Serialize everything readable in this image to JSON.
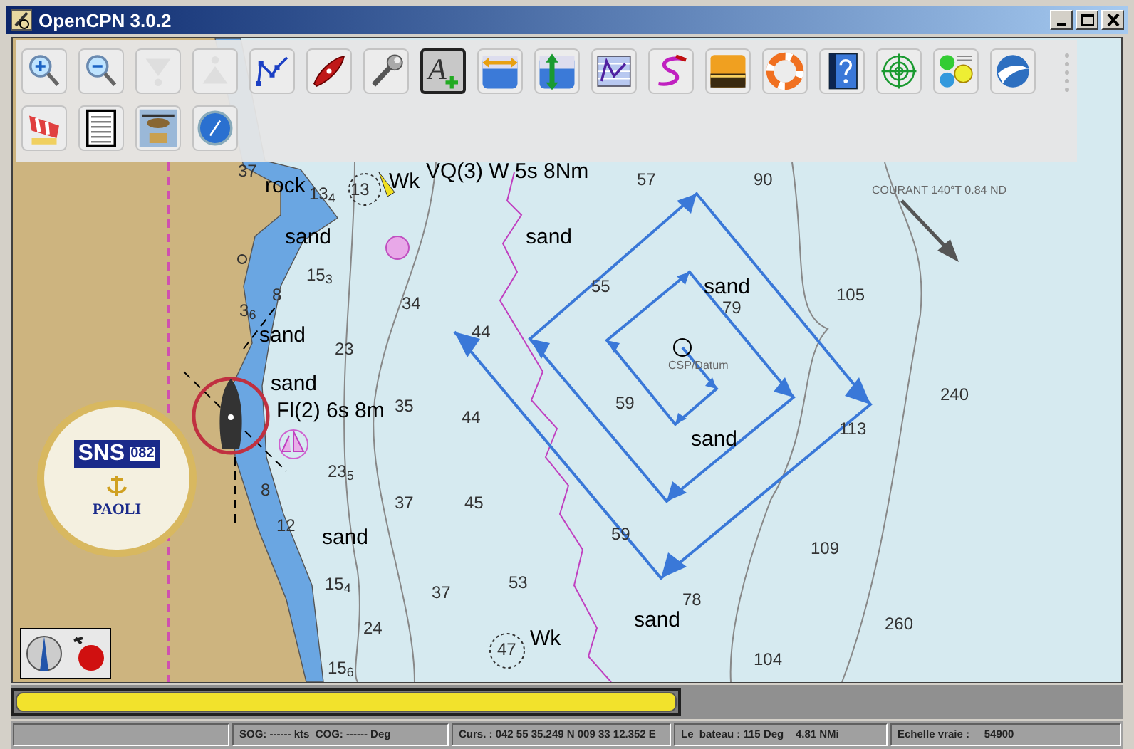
{
  "window": {
    "title": "OpenCPN 3.0.2"
  },
  "toolbar": {
    "rows": [
      [
        {
          "kind": "zoom-in",
          "selected": false,
          "disabled": false
        },
        {
          "kind": "zoom-out",
          "selected": false,
          "disabled": false
        },
        {
          "kind": "scale-in",
          "selected": false,
          "disabled": true
        },
        {
          "kind": "scale-out",
          "selected": false,
          "disabled": true
        },
        {
          "kind": "route",
          "selected": false,
          "disabled": false
        },
        {
          "kind": "boat",
          "selected": false,
          "disabled": false
        },
        {
          "kind": "settings",
          "selected": false,
          "disabled": false
        },
        {
          "kind": "text",
          "selected": true,
          "disabled": false,
          "glyph": "A"
        },
        {
          "kind": "tide",
          "selected": false,
          "disabled": false
        },
        {
          "kind": "current",
          "selected": false,
          "disabled": false
        },
        {
          "kind": "route-manager",
          "selected": false,
          "disabled": false
        },
        {
          "kind": "track",
          "selected": false,
          "disabled": false
        },
        {
          "kind": "sunset",
          "selected": false,
          "disabled": false
        },
        {
          "kind": "lifebuoy",
          "selected": false,
          "disabled": false
        },
        {
          "kind": "help",
          "selected": false,
          "disabled": false
        },
        {
          "kind": "target",
          "selected": false,
          "disabled": false
        },
        {
          "kind": "dashboard",
          "selected": false,
          "disabled": false
        },
        {
          "kind": "globe",
          "selected": false,
          "disabled": false
        }
      ],
      [
        {
          "kind": "windsock",
          "selected": false,
          "disabled": false
        },
        {
          "kind": "document",
          "selected": false,
          "disabled": false
        },
        {
          "kind": "helicopter",
          "selected": false,
          "disabled": false
        },
        {
          "kind": "compass",
          "selected": false,
          "disabled": false
        }
      ]
    ]
  },
  "chart": {
    "labels": [
      {
        "text": "37",
        "kind": "sounding"
      },
      {
        "text": "rock",
        "kind": "feature"
      },
      {
        "text": "13$_{4}$",
        "kind": "sounding"
      },
      {
        "text": "13",
        "kind": "sounding"
      },
      {
        "text": "Wk",
        "kind": "feature"
      },
      {
        "text": "VQ(3) W 5s 8Nm",
        "kind": "feature"
      },
      {
        "text": "sand",
        "kind": "feature"
      },
      {
        "text": "sand",
        "kind": "feature"
      },
      {
        "text": "15$_{3}$",
        "kind": "sounding"
      },
      {
        "text": "8",
        "kind": "sounding"
      },
      {
        "text": "3$_{6}$",
        "kind": "sounding"
      },
      {
        "text": "34",
        "kind": "sounding"
      },
      {
        "text": "sand",
        "kind": "feature"
      },
      {
        "text": "23",
        "kind": "sounding"
      },
      {
        "text": "44",
        "kind": "sounding"
      },
      {
        "text": "sand",
        "kind": "feature"
      },
      {
        "text": "Fl(2) 6s 8m",
        "kind": "feature"
      },
      {
        "text": "35",
        "kind": "sounding"
      },
      {
        "text": "44",
        "kind": "sounding"
      },
      {
        "text": "23$_{5}$",
        "kind": "sounding"
      },
      {
        "text": "37",
        "kind": "sounding"
      },
      {
        "text": "45",
        "kind": "sounding"
      },
      {
        "text": "8",
        "kind": "sounding"
      },
      {
        "text": "12",
        "kind": "sounding"
      },
      {
        "text": "sand",
        "kind": "feature"
      },
      {
        "text": "15$_{4}$",
        "kind": "sounding"
      },
      {
        "text": "37",
        "kind": "sounding"
      },
      {
        "text": "53",
        "kind": "sounding"
      },
      {
        "text": "24",
        "kind": "sounding"
      },
      {
        "text": "Wk",
        "kind": "feature"
      },
      {
        "text": "47",
        "kind": "sounding"
      },
      {
        "text": "15$_{6}$",
        "kind": "sounding"
      },
      {
        "text": "57",
        "kind": "sounding"
      },
      {
        "text": "90",
        "kind": "sounding"
      },
      {
        "text": "COURANT 140°T 0.84 ND",
        "kind": "note"
      },
      {
        "text": "55",
        "kind": "sounding"
      },
      {
        "text": "sand",
        "kind": "feature"
      },
      {
        "text": "79",
        "kind": "sounding"
      },
      {
        "text": "105",
        "kind": "sounding"
      },
      {
        "text": "CSP/Datum",
        "kind": "note"
      },
      {
        "text": "59",
        "kind": "sounding"
      },
      {
        "text": "240",
        "kind": "sounding"
      },
      {
        "text": "sand",
        "kind": "feature"
      },
      {
        "text": "113",
        "kind": "sounding"
      },
      {
        "text": "59",
        "kind": "sounding"
      },
      {
        "text": "109",
        "kind": "sounding"
      },
      {
        "text": "78",
        "kind": "sounding"
      },
      {
        "text": "sand",
        "kind": "feature"
      },
      {
        "text": "260",
        "kind": "sounding"
      },
      {
        "text": "104",
        "kind": "sounding"
      }
    ],
    "emblem": {
      "letters": "SNS",
      "number": "082",
      "place": "PAOLI"
    }
  },
  "status_bar": {
    "fields": [
      "SOG: ------ kts  COG: ------ Deg",
      "Curs. : 042 55 35.249 N 009 33 12.352 E",
      "Le  bateau : 115 Deg    4.81 NMi",
      "Echelle vraie :     54900"
    ]
  }
}
